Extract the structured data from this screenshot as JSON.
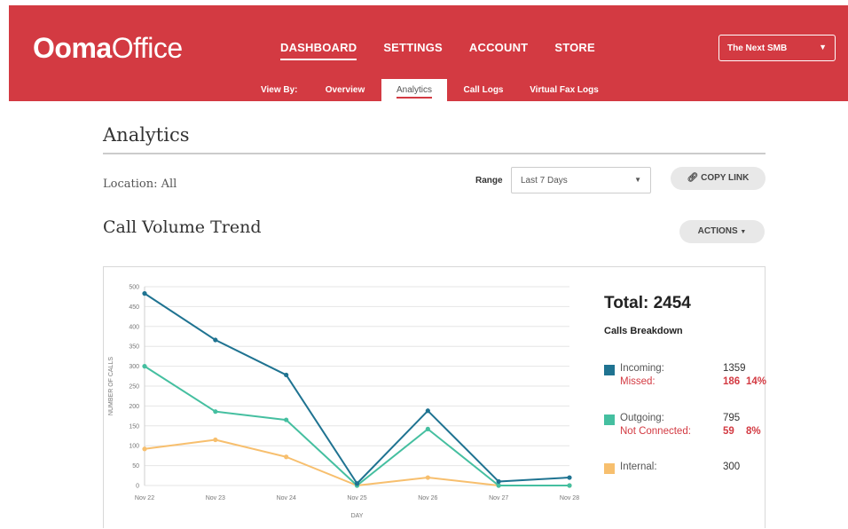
{
  "header": {
    "logo_bold": "Ooma",
    "logo_light": "Office",
    "nav": [
      "DASHBOARD",
      "SETTINGS",
      "ACCOUNT",
      "STORE"
    ],
    "account_select": "The Next SMB",
    "view_by": "View By:",
    "tabs": [
      "Overview",
      "Analytics",
      "Call Logs",
      "Virtual Fax Logs"
    ]
  },
  "page": {
    "title": "Analytics",
    "location": "Location: All",
    "range_label": "Range",
    "range_value": "Last 7 Days",
    "copy_link": "COPY LINK",
    "section_title": "Call Volume Trend",
    "actions": "ACTIONS"
  },
  "summary": {
    "total": "Total: 2454",
    "breakdown_title": "Calls Breakdown",
    "incoming_label": "Incoming:",
    "incoming_value": "1359",
    "missed_label": "Missed:",
    "missed_value": "186",
    "missed_pct": "14%",
    "outgoing_label": "Outgoing:",
    "outgoing_value": "795",
    "not_connected_label": "Not Connected:",
    "not_connected_value": "59",
    "not_connected_pct": "8%",
    "internal_label": "Internal:",
    "internal_value": "300"
  },
  "colors": {
    "brand": "#d33a42",
    "incoming": "#1f7391",
    "outgoing": "#45bfa0",
    "internal": "#f7bf6e"
  },
  "chart_data": {
    "type": "line",
    "categories": [
      "Nov 22",
      "Nov 23",
      "Nov 24",
      "Nov 25",
      "Nov 26",
      "Nov 27",
      "Nov 28"
    ],
    "series": [
      {
        "name": "Incoming",
        "values": [
          483,
          366,
          278,
          5,
          188,
          10,
          20
        ]
      },
      {
        "name": "Outgoing",
        "values": [
          300,
          186,
          165,
          0,
          142,
          0,
          0
        ]
      },
      {
        "name": "Internal",
        "values": [
          92,
          115,
          72,
          0,
          20,
          0,
          0
        ]
      }
    ],
    "xlabel": "DAY",
    "ylabel": "NUMBER OF CALLS",
    "ylim": [
      0,
      500
    ],
    "yticks": [
      0,
      50,
      100,
      150,
      200,
      250,
      300,
      350,
      400,
      450,
      500
    ],
    "grid": true
  }
}
